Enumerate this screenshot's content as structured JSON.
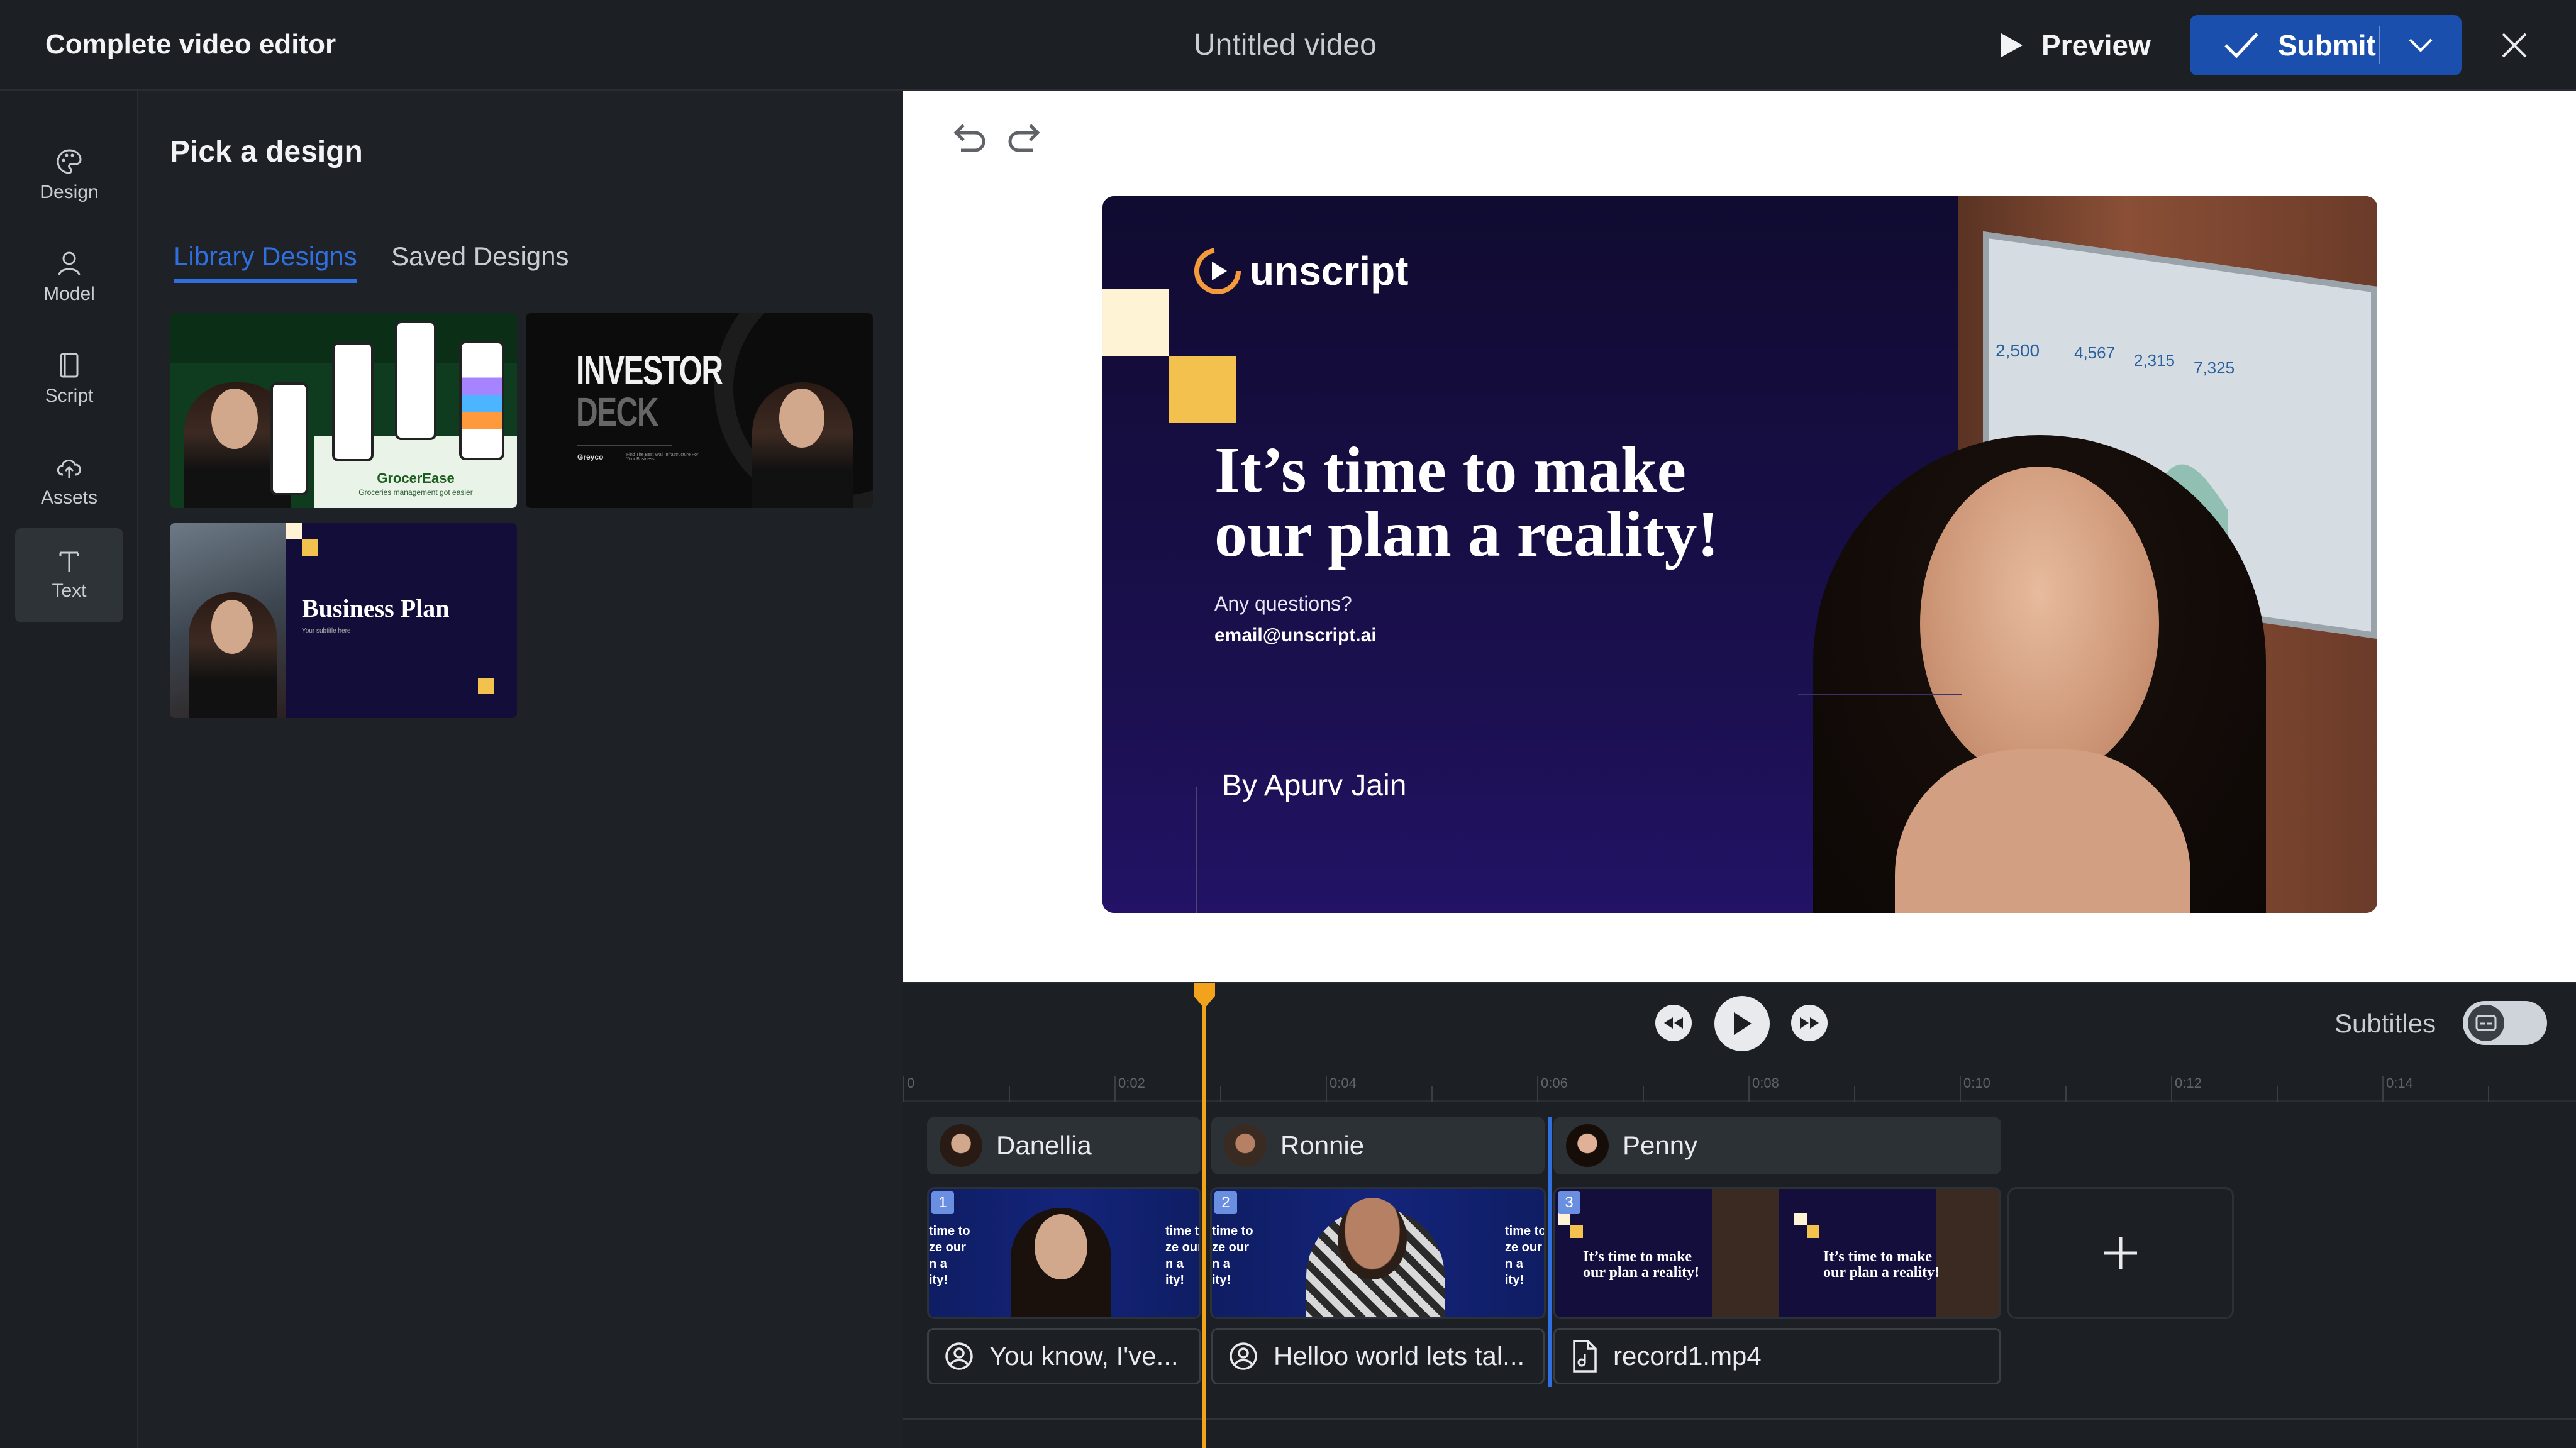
{
  "topbar": {
    "app_title": "Complete video editor",
    "video_title": "Untitled video",
    "preview_label": "Preview",
    "submit_label": "Submit"
  },
  "rail": {
    "items": [
      {
        "label": "Design",
        "icon": "palette-icon"
      },
      {
        "label": "Model",
        "icon": "person-icon"
      },
      {
        "label": "Script",
        "icon": "script-icon"
      },
      {
        "label": "Assets",
        "icon": "cloud-upload-icon"
      },
      {
        "label": "Text",
        "icon": "text-icon"
      }
    ],
    "active": "Text"
  },
  "panel": {
    "title": "Pick a design",
    "tabs": [
      {
        "label": "Library Designs",
        "active": true
      },
      {
        "label": "Saved Designs",
        "active": false
      }
    ],
    "cards": [
      {
        "title": "GrocerEase",
        "subtitle": "Groceries management got easier"
      },
      {
        "title_line1": "INVESTOR",
        "title_line2": "DECK",
        "brand": "Greyco",
        "tagline": "Find The Best Wall Infrastructure For Your Business"
      },
      {
        "title": "Business Plan",
        "subtitle": "Your subtitle here"
      }
    ]
  },
  "slide": {
    "brand": "unscript",
    "headline_line1": "It’s time to make",
    "headline_line2": "our plan a reality!",
    "question": "Any questions?",
    "email": "email@unscript.ai",
    "byline": "By Apurv Jain",
    "laptop_stats": [
      "2,500",
      "4,567",
      "2,315",
      "7,325"
    ]
  },
  "timeline": {
    "subtitles_label": "Subtitles",
    "subtitles_on": false,
    "ticks": [
      "0",
      "0:02",
      "0:04",
      "0:06",
      "0:08",
      "0:10",
      "0:12",
      "0:14"
    ],
    "speakers": [
      "Danellia",
      "Ronnie",
      "Penny"
    ],
    "clips": [
      {
        "num": "1",
        "text_a": "time to\nze our\nn a\nity!",
        "text_b": "time t\nze our\nn a\nity!"
      },
      {
        "num": "2",
        "text_a": "time to\nze our\nn a\nity!",
        "text_b": "time to\nze our\nn a\nity!"
      },
      {
        "num": "3",
        "text_a": "It’s time to make\nour plan a reality!",
        "text_b": "It’s time to make\nour plan a reality!"
      }
    ],
    "scripts": [
      {
        "label": "You know, I've...",
        "icon": "avatar-script-icon"
      },
      {
        "label": "Helloo world lets tal...",
        "icon": "avatar-script-icon"
      },
      {
        "label": "record1.mp4",
        "icon": "audio-file-icon"
      }
    ],
    "playhead_color": "#f3a31b"
  },
  "colors": {
    "accent": "#2f6fe0",
    "submit_bg": "#1a4fae",
    "slide_bg": "#110c35",
    "slide_yellow": "#f2c14e"
  }
}
